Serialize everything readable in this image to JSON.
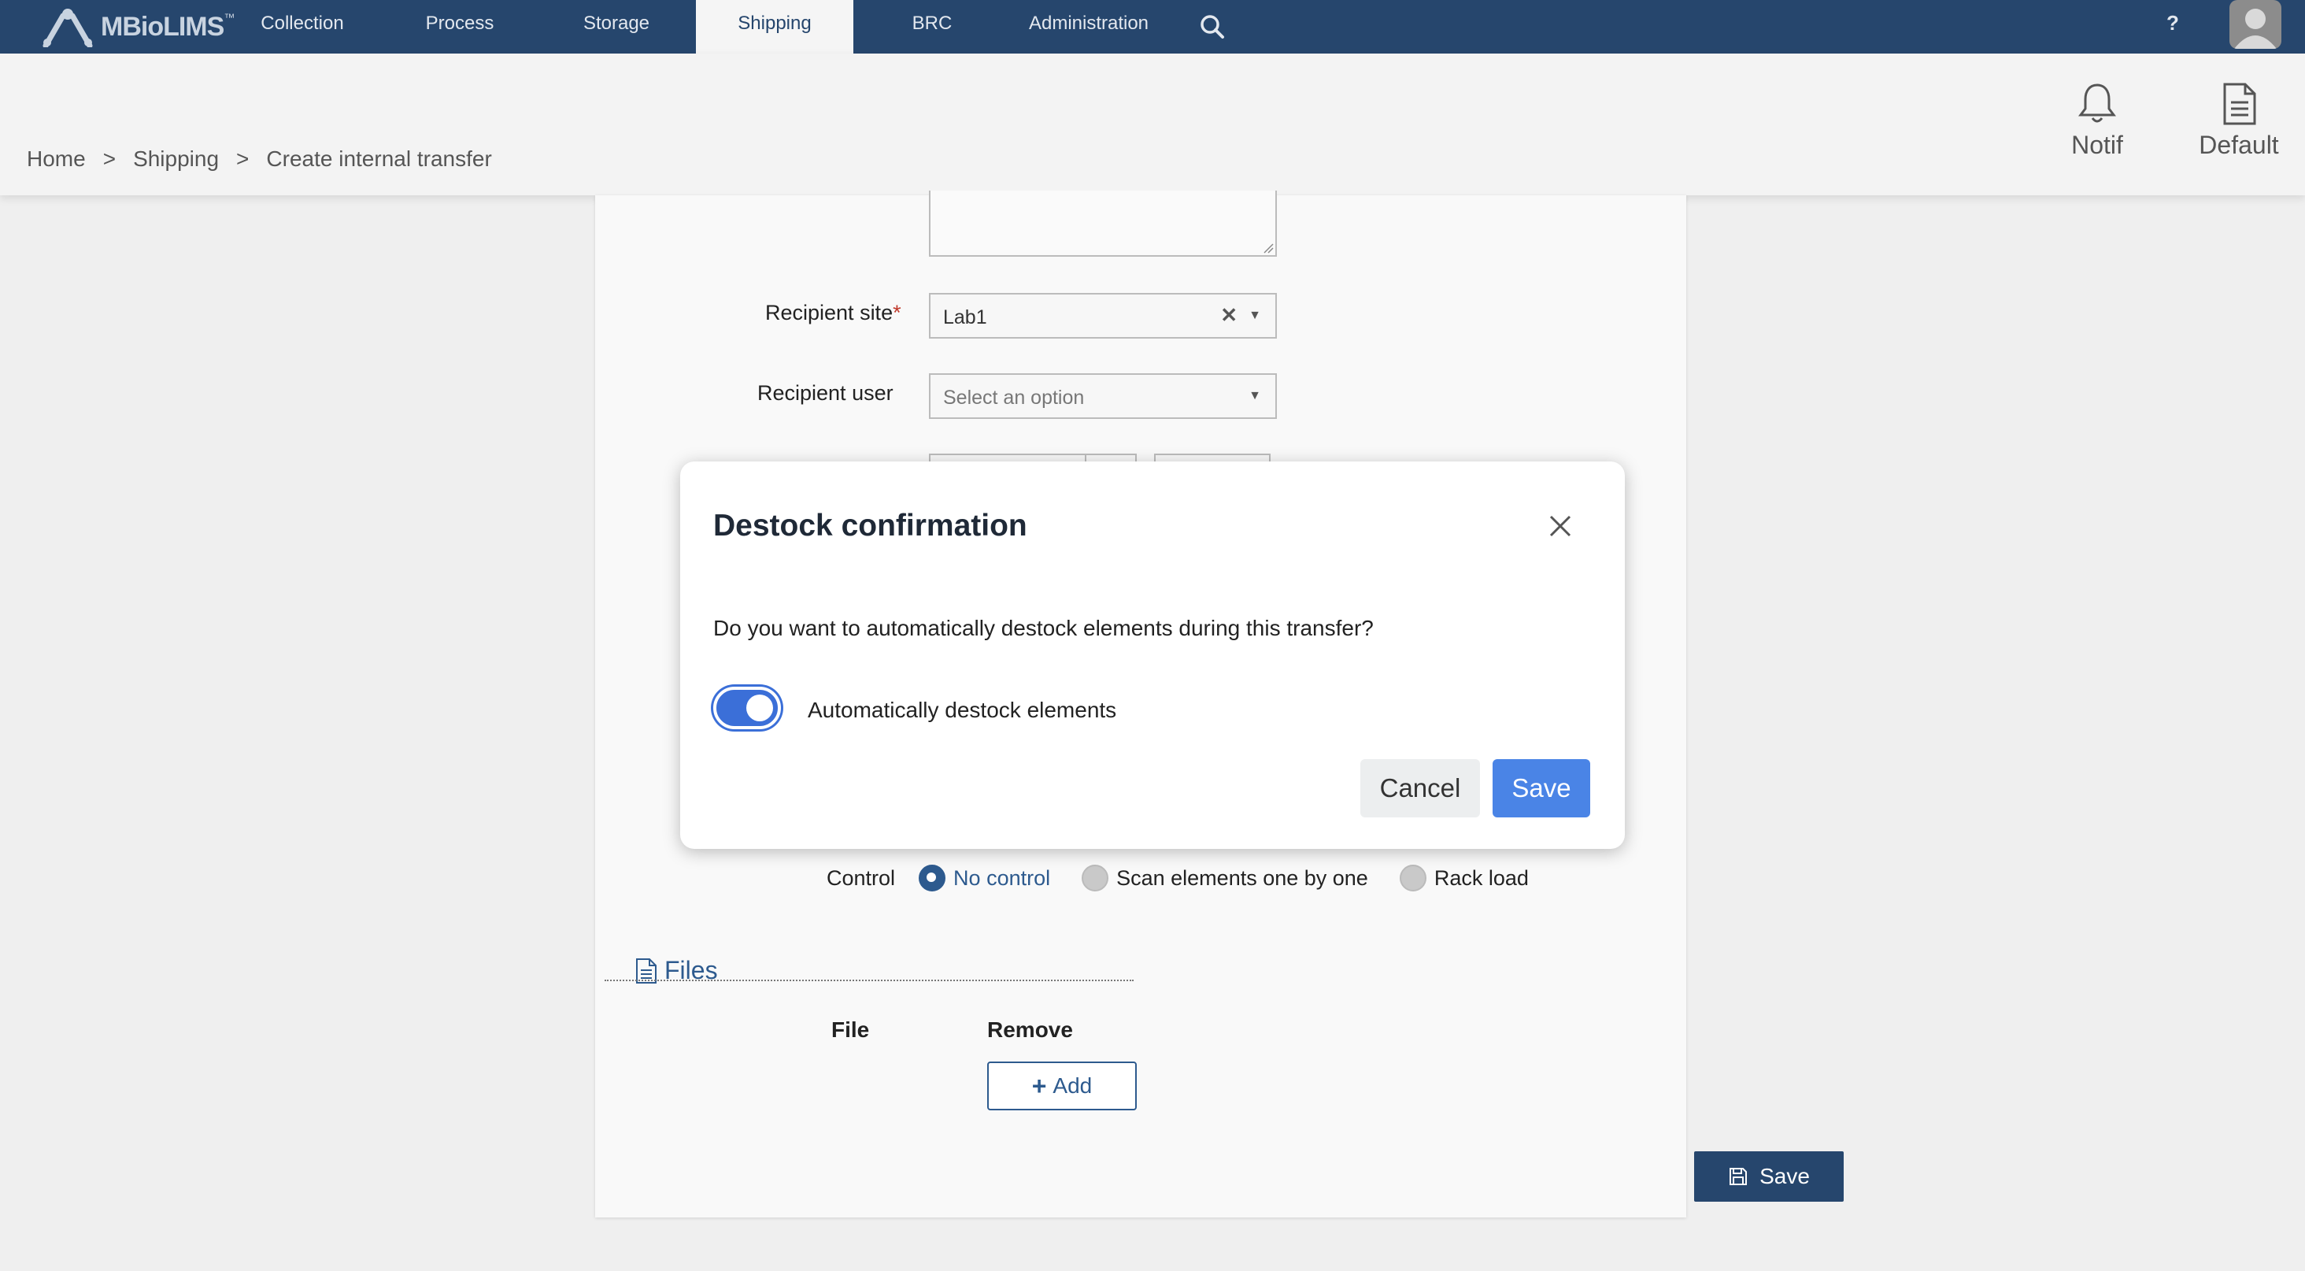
{
  "app": {
    "logo_text": "MBioLIMS",
    "logo_tm": "™"
  },
  "nav": {
    "items": [
      {
        "label": "Collection"
      },
      {
        "label": "Process"
      },
      {
        "label": "Storage"
      },
      {
        "label": "Shipping",
        "active": true
      },
      {
        "label": "BRC"
      },
      {
        "label": "Administration"
      }
    ],
    "help_label": "?"
  },
  "header": {
    "breadcrumb": [
      "Home",
      "Shipping",
      "Create internal transfer"
    ],
    "breadcrumb_sep": ">",
    "notif_label": "Notif",
    "default_label": "Default"
  },
  "form": {
    "recipient_site": {
      "label": "Recipient site",
      "required": "*",
      "value": "Lab1"
    },
    "recipient_user": {
      "label": "Recipient user",
      "placeholder": "Select an option"
    },
    "control": {
      "label": "Control",
      "options": [
        {
          "label": "No control",
          "selected": true
        },
        {
          "label": "Scan elements one by one",
          "selected": false
        },
        {
          "label": "Rack load",
          "selected": false
        }
      ]
    },
    "files": {
      "title": "Files",
      "col_file": "File",
      "col_remove": "Remove",
      "add_label": "Add"
    },
    "save_label": "Save"
  },
  "modal": {
    "title": "Destock confirmation",
    "question": "Do you want to automatically destock elements during this transfer?",
    "toggle_label": "Automatically destock elements",
    "toggle_on": true,
    "cancel_label": "Cancel",
    "save_label": "Save"
  },
  "colors": {
    "nav_bg": "#26466d",
    "primary": "#2d5a8e",
    "modal_save": "#4a84e6",
    "toggle_on": "#3b6fd8"
  }
}
